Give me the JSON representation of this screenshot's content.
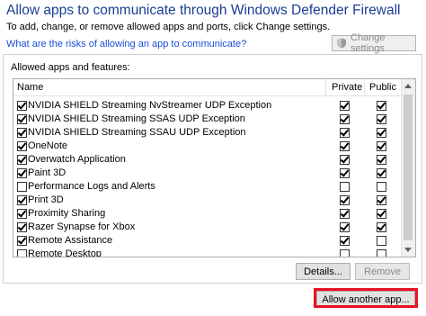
{
  "header": {
    "title": "Allow apps to communicate through Windows Defender Firewall",
    "subtitle": "To add, change, or remove allowed apps and ports, click Change settings.",
    "risk_link": "What are the risks of allowing an app to communicate?",
    "change_settings_label": "Change settings"
  },
  "panel": {
    "label": "Allowed apps and features:",
    "columns": {
      "name": "Name",
      "private": "Private",
      "public": "Public"
    },
    "rows": [
      {
        "name": "NVIDIA SHIELD Streaming NvStreamer UDP Exception",
        "enabled": true,
        "private": true,
        "public": true
      },
      {
        "name": "NVIDIA SHIELD Streaming SSAS UDP Exception",
        "enabled": true,
        "private": true,
        "public": true
      },
      {
        "name": "NVIDIA SHIELD Streaming SSAU UDP Exception",
        "enabled": true,
        "private": true,
        "public": true
      },
      {
        "name": "OneNote",
        "enabled": true,
        "private": true,
        "public": true
      },
      {
        "name": "Overwatch Application",
        "enabled": true,
        "private": true,
        "public": true
      },
      {
        "name": "Paint 3D",
        "enabled": true,
        "private": true,
        "public": true
      },
      {
        "name": "Performance Logs and Alerts",
        "enabled": false,
        "private": false,
        "public": false
      },
      {
        "name": "Print 3D",
        "enabled": true,
        "private": true,
        "public": true
      },
      {
        "name": "Proximity Sharing",
        "enabled": true,
        "private": true,
        "public": true
      },
      {
        "name": "Razer Synapse for Xbox",
        "enabled": true,
        "private": true,
        "public": true
      },
      {
        "name": "Remote Assistance",
        "enabled": true,
        "private": true,
        "public": false
      },
      {
        "name": "Remote Desktop",
        "enabled": false,
        "private": false,
        "public": false
      }
    ],
    "details_label": "Details...",
    "remove_label": "Remove"
  },
  "footer": {
    "allow_another_label": "Allow another app...",
    "highlight_color": "#e81123"
  }
}
